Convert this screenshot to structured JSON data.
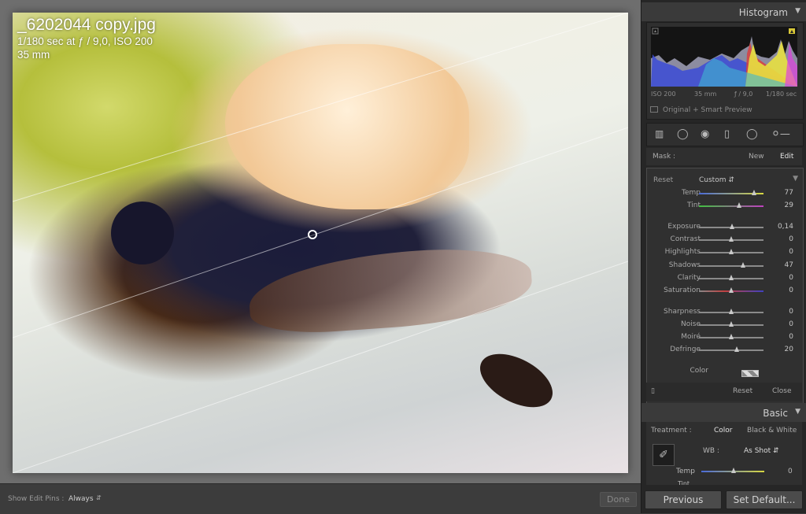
{
  "photo_info": {
    "filename": "_6202044 copy.jpg",
    "exposure": "1/180 sec at ƒ / 9,0, ISO 200",
    "focal": "35 mm"
  },
  "toolbar": {
    "edit_pins_label": "Show Edit Pins :",
    "edit_pins_value": "Always",
    "done": "Done"
  },
  "histogram": {
    "title": "Histogram",
    "iso": "ISO 200",
    "focal": "35 mm",
    "aperture": "ƒ / 9,0",
    "shutter": "1/180 sec",
    "preview": "Original + Smart Preview"
  },
  "mask": {
    "label": "Mask :",
    "new": "New",
    "edit": "Edit"
  },
  "brush": {
    "reset": "Reset",
    "preset": "Custom",
    "rows": [
      {
        "label": "Temp",
        "value": "77",
        "level": 0.85,
        "track": "temp"
      },
      {
        "label": "Tint",
        "value": "29",
        "level": 0.62,
        "track": "tint"
      },
      {
        "label": "Exposure",
        "value": "0,14",
        "level": 0.51,
        "track": "gray"
      },
      {
        "label": "Contrast",
        "value": "0",
        "level": 0.5,
        "track": "gray"
      },
      {
        "label": "Highlights",
        "value": "0",
        "level": 0.5,
        "track": "gray"
      },
      {
        "label": "Shadows",
        "value": "47",
        "level": 0.68,
        "track": "gray"
      },
      {
        "label": "Clarity",
        "value": "0",
        "level": 0.5,
        "track": "gray"
      },
      {
        "label": "Saturation",
        "value": "0",
        "level": 0.5,
        "track": "sat"
      },
      {
        "label": "Sharpness",
        "value": "0",
        "level": 0.5,
        "track": "gray"
      },
      {
        "label": "Noise",
        "value": "0",
        "level": 0.5,
        "track": "gray"
      },
      {
        "label": "Moiré",
        "value": "0",
        "level": 0.5,
        "track": "gray"
      },
      {
        "label": "Defringe",
        "value": "20",
        "level": 0.58,
        "track": "gray"
      }
    ],
    "color_label": "Color",
    "foot_reset": "Reset",
    "foot_close": "Close"
  },
  "basic": {
    "title": "Basic",
    "treatment_label": "Treatment :",
    "treatment_color": "Color",
    "treatment_bw": "Black & White",
    "wb_label": "WB :",
    "wb_value": "As Shot",
    "temp_label": "Temp",
    "temp_value": "0",
    "tint_label": "Tint"
  },
  "buttons": {
    "previous": "Previous",
    "set_default": "Set Default..."
  },
  "colors": {
    "panel_bg": "#262626",
    "header_bg": "#3a3a3a",
    "accent_text": "#d2d2d2"
  }
}
